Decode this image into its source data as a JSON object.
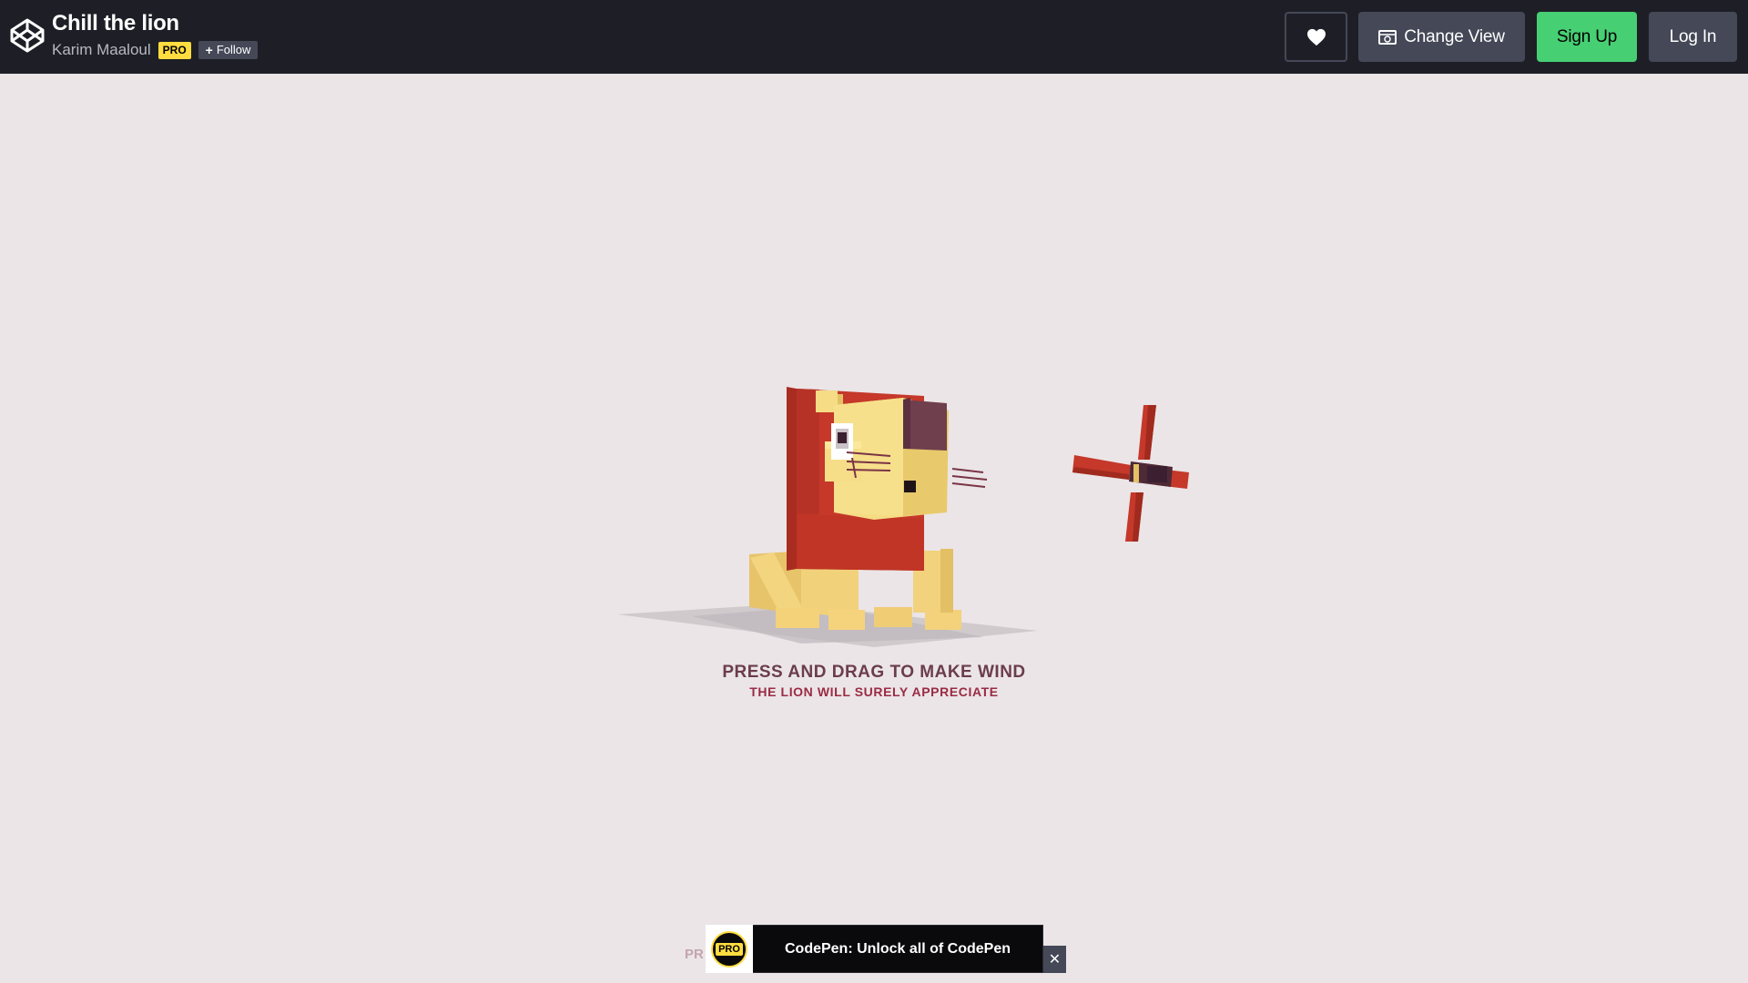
{
  "header": {
    "title": "Chill the lion",
    "author": "Karim Maaloul",
    "pro_badge": "PRO",
    "follow_label": "Follow",
    "heart_icon": "heart-icon",
    "change_view_label": "Change View",
    "signup_label": "Sign Up",
    "login_label": "Log In"
  },
  "canvas": {
    "instruction": "PRESS AND DRAG TO MAKE WIND",
    "subinstruction": "THE LION WILL SURELY APPRECIATE"
  },
  "promo": {
    "peek_text": "PR",
    "icon_label": "PRO",
    "text": "CodePen: Unlock all of CodePen",
    "close_label": "✕"
  },
  "colors": {
    "header_bg": "#1e1f26",
    "canvas_bg": "#ebe5e7",
    "signup_green": "#47cf73",
    "pro_yellow": "#ffdd40",
    "mane_red": "#c5382a",
    "lion_yellow": "#f5d97e",
    "ear_purple": "#6f3f4e"
  }
}
